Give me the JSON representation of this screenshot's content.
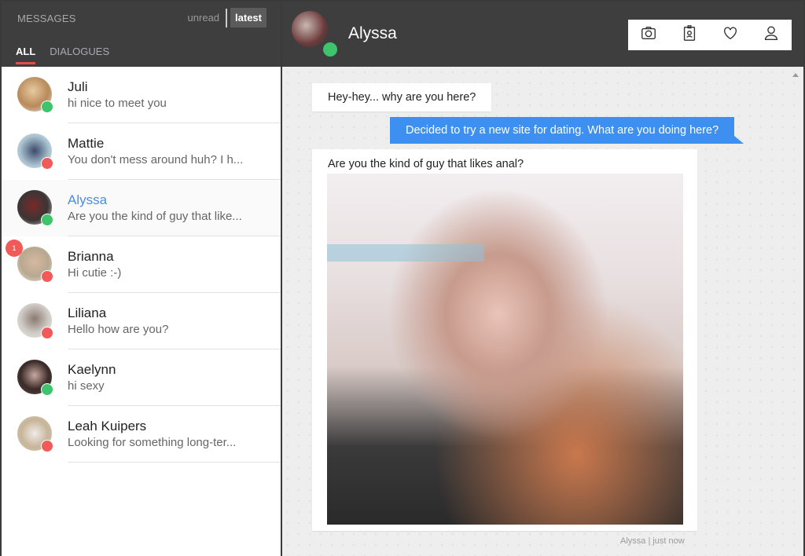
{
  "sidebar": {
    "title": "MESSAGES",
    "sort": {
      "unread": "unread",
      "latest": "latest",
      "active": "latest"
    },
    "tabs": [
      {
        "label": "ALL",
        "active": true
      },
      {
        "label": "DIALOGUES",
        "active": false
      }
    ],
    "contacts": [
      {
        "name": "Juli",
        "preview": "hi nice to meet you",
        "online": true,
        "selected": false,
        "unread": null
      },
      {
        "name": "Mattie",
        "preview": "You don't mess around huh? I h...",
        "online": false,
        "selected": false,
        "unread": null
      },
      {
        "name": "Alyssa",
        "preview": "Are you the kind of guy that like...",
        "online": true,
        "selected": true,
        "unread": null
      },
      {
        "name": "Brianna",
        "preview": "Hi cutie :-)",
        "online": false,
        "selected": false,
        "unread": "1"
      },
      {
        "name": "Liliana",
        "preview": "Hello how are you?",
        "online": false,
        "selected": false,
        "unread": null
      },
      {
        "name": "Kaelynn",
        "preview": "hi sexy",
        "online": true,
        "selected": false,
        "unread": null
      },
      {
        "name": "Leah Kuipers",
        "preview": "Looking for something long-ter...",
        "online": false,
        "selected": false,
        "unread": null
      }
    ]
  },
  "chat": {
    "contact_name": "Alyssa",
    "actions": [
      {
        "icon": "camera-icon"
      },
      {
        "icon": "id-badge-icon"
      },
      {
        "icon": "heart-icon"
      },
      {
        "icon": "user-icon"
      }
    ],
    "messages": [
      {
        "from": "Alyssa",
        "text": "Hey-hey... why are you here?"
      },
      {
        "from": "me",
        "text": "Decided to try a new site for dating. What are you doing here?"
      },
      {
        "from": "Alyssa",
        "text": "Are you the kind of guy that likes anal?",
        "has_image": true
      }
    ],
    "last_meta": "Alyssa | just now"
  },
  "colors": {
    "accent_blue": "#3d8ff0",
    "online": "#3ec46d",
    "offline": "#f25a5a",
    "tab_underline": "#e74c4c"
  }
}
